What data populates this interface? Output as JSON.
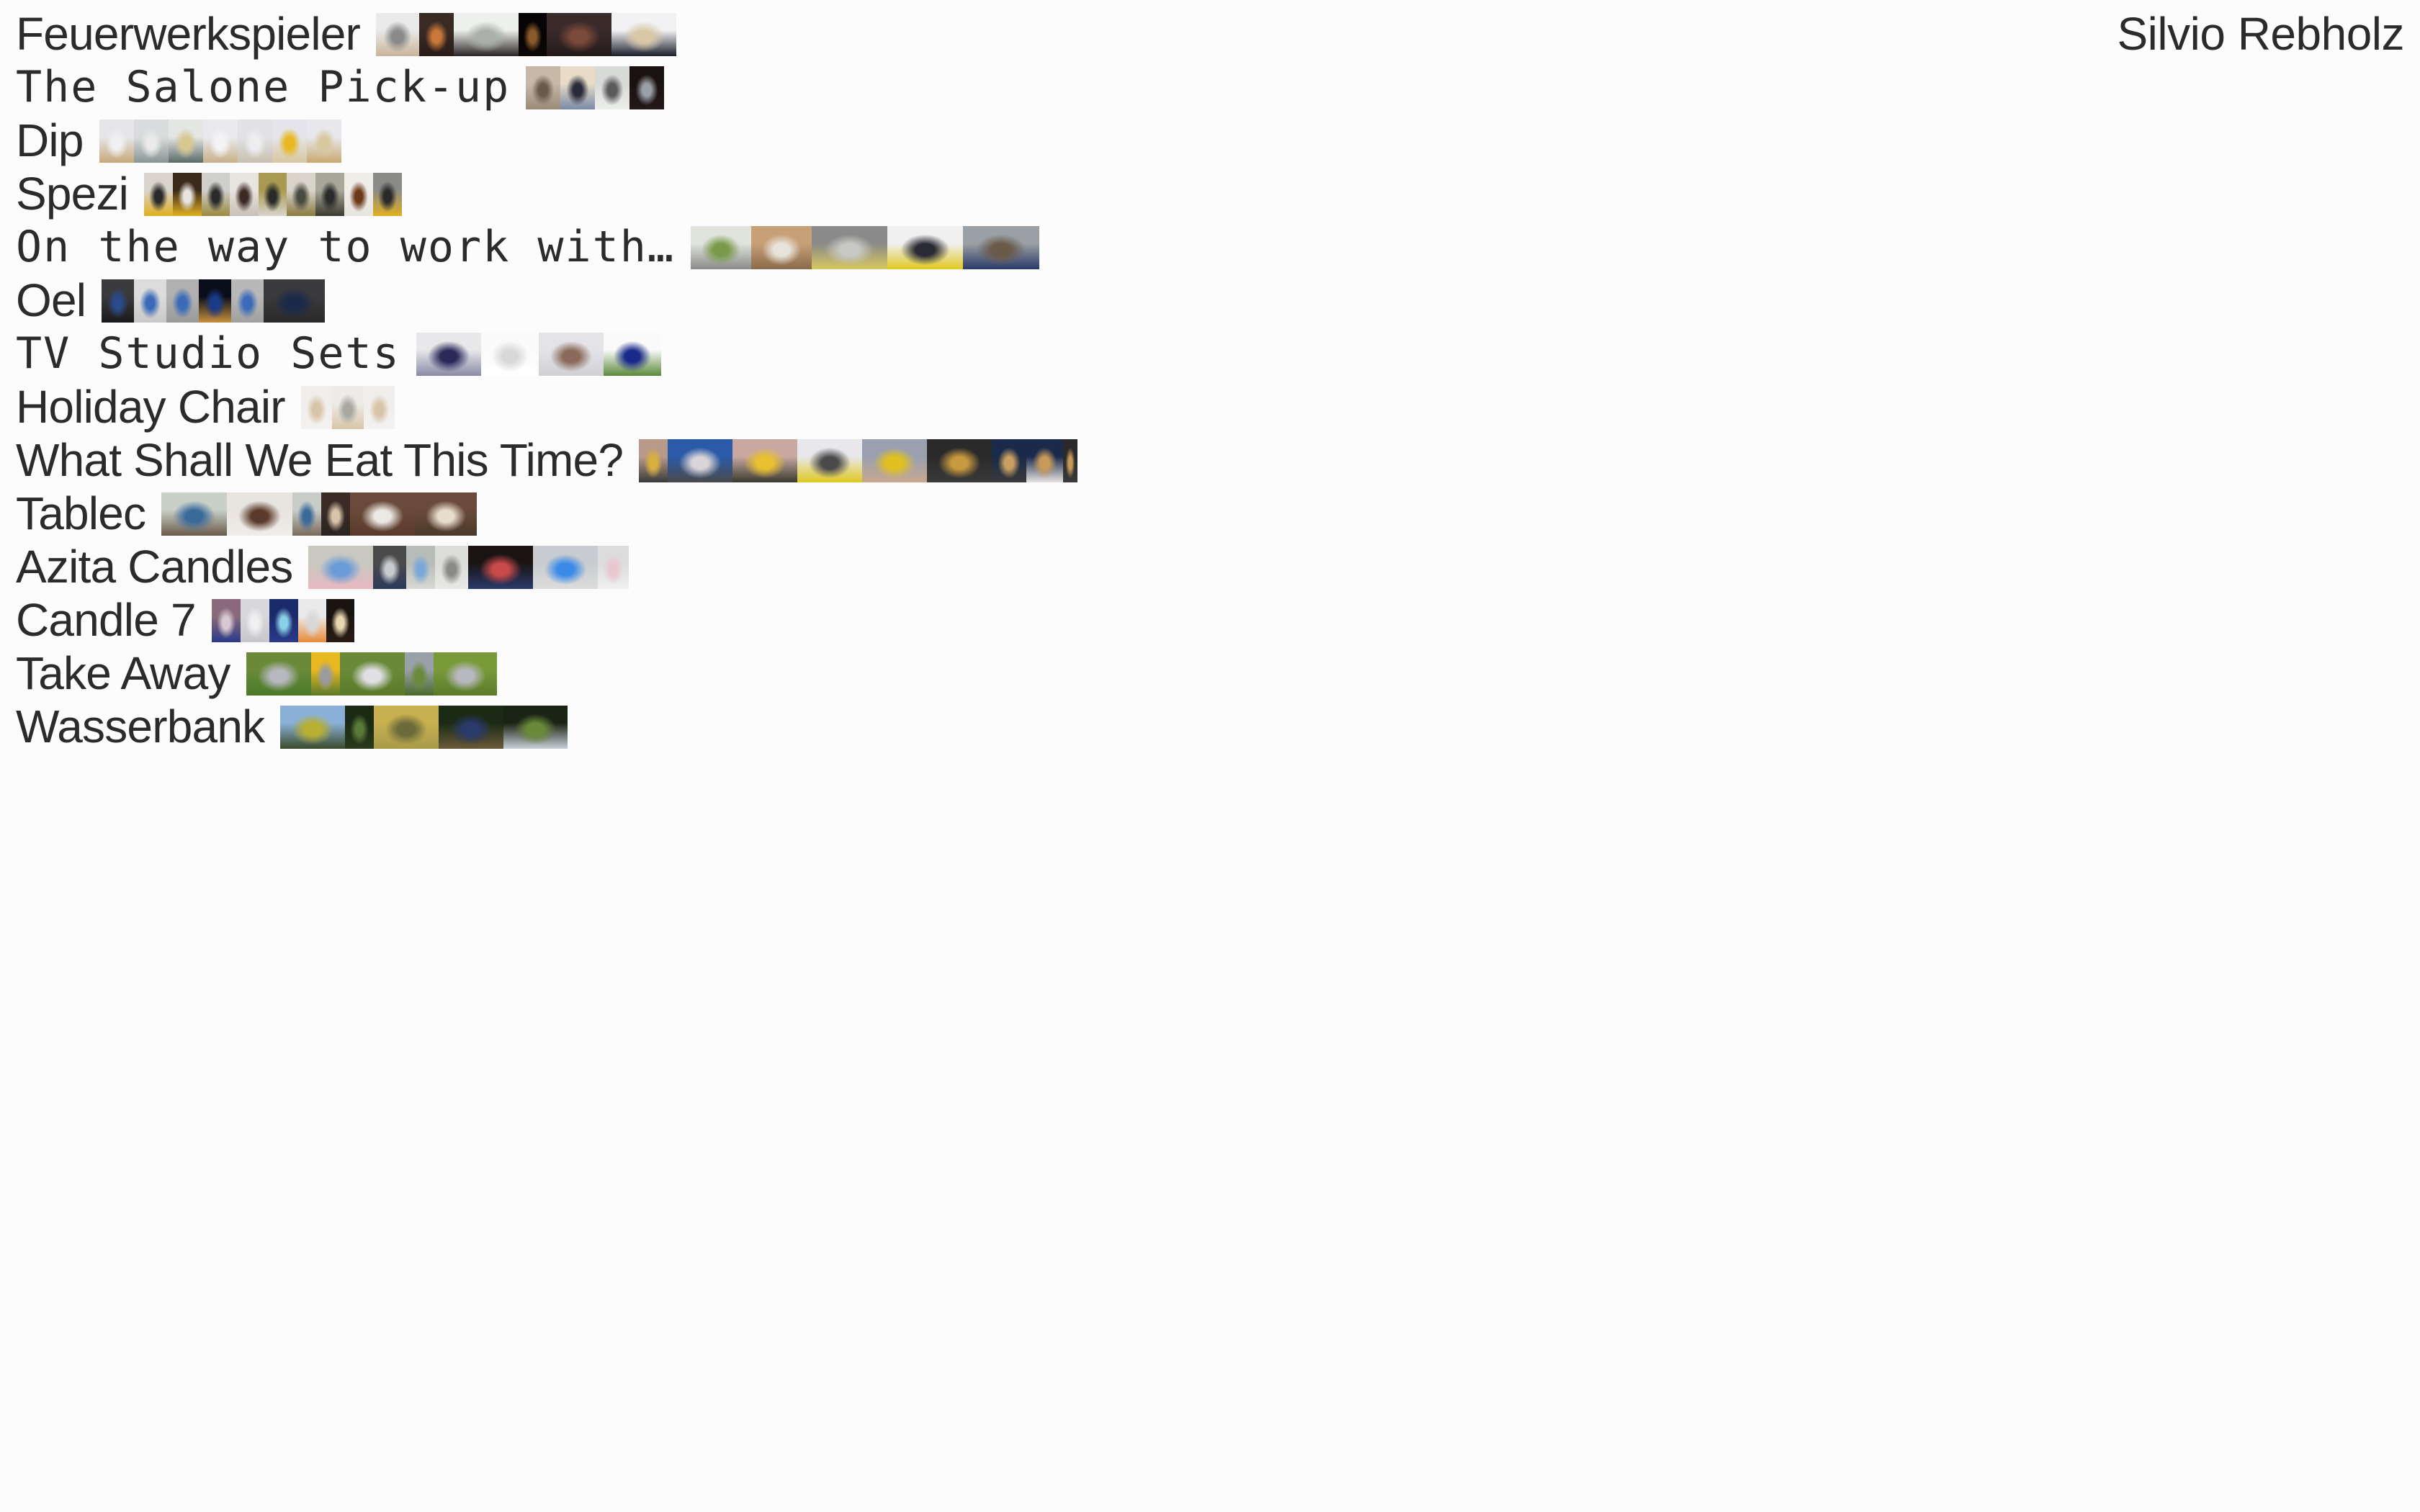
{
  "site": {
    "author": "Silvio Rebholz",
    "background": "#fdfcfd",
    "text_color": "#2b2b2b"
  },
  "projects": [
    {
      "title": "Feuerwerkspieler",
      "font": "sans",
      "thumbnails": [
        {
          "w": 60,
          "c": [
            "#e9e9ea",
            "#8a8a8a",
            "#c9b49a"
          ]
        },
        {
          "w": 48,
          "c": [
            "#3a2a24",
            "#c9783a",
            "#2a1c18"
          ]
        },
        {
          "w": 90,
          "c": [
            "#eef0ee",
            "#a8b0a8",
            "#2a2424"
          ]
        },
        {
          "w": 39,
          "c": [
            "#060404",
            "#8a5a2a",
            "#0c0806"
          ]
        },
        {
          "w": 90,
          "c": [
            "#3a2a2a",
            "#7a4a3a",
            "#241a1a"
          ]
        },
        {
          "w": 90,
          "c": [
            "#f2f2f4",
            "#d8c8a8",
            "#1a1e2a"
          ]
        }
      ]
    },
    {
      "title": "The Salone Pick-up",
      "font": "mono",
      "thumbnails": [
        {
          "w": 48,
          "c": [
            "#c8b8a8",
            "#6a5a4a",
            "#9a8a78"
          ]
        },
        {
          "w": 48,
          "c": [
            "#e8dcc8",
            "#2a2a3a",
            "#7a8aa8"
          ]
        },
        {
          "w": 48,
          "c": [
            "#d8dad8",
            "#5a5a5a",
            "#eceeec"
          ]
        },
        {
          "w": 48,
          "c": [
            "#1a1210",
            "#9aa0a8",
            "#24181a"
          ]
        }
      ]
    },
    {
      "title": "Dip",
      "font": "sans",
      "thumbnails": [
        {
          "w": 48,
          "c": [
            "#e6e6ea",
            "#f0f0f2",
            "#c8a878"
          ]
        },
        {
          "w": 48,
          "c": [
            "#d8dcdc",
            "#eaeaea",
            "#8a9494"
          ]
        },
        {
          "w": 48,
          "c": [
            "#e4e6e4",
            "#d8c890",
            "#5a6a68"
          ]
        },
        {
          "w": 48,
          "c": [
            "#eaeaee",
            "#f4f4f6",
            "#c8b088"
          ]
        },
        {
          "w": 48,
          "c": [
            "#e2e2e6",
            "#eeeef0",
            "#c8c0b0"
          ]
        },
        {
          "w": 48,
          "c": [
            "#e4e4ea",
            "#e8b820",
            "#d8c8a0"
          ]
        },
        {
          "w": 48,
          "c": [
            "#e8e8ec",
            "#d8c8a0",
            "#c8a870"
          ]
        }
      ]
    },
    {
      "title": "Spezi",
      "font": "sans",
      "thumbnails": [
        {
          "w": 40,
          "c": [
            "#d8d4cc",
            "#2a2a2a",
            "#e0b020"
          ]
        },
        {
          "w": 40,
          "c": [
            "#3a2a1a",
            "#e8e4e0",
            "#e0b020"
          ]
        },
        {
          "w": 39,
          "c": [
            "#cfcfcc",
            "#2a2a2a",
            "#9a8a40"
          ]
        },
        {
          "w": 40,
          "c": [
            "#e8e4e0",
            "#3a2a24",
            "#c8c0b8"
          ]
        },
        {
          "w": 39,
          "c": [
            "#a89a50",
            "#2a2a2a",
            "#d8d4cc"
          ]
        },
        {
          "w": 40,
          "c": [
            "#d8d4cc",
            "#4a4a40",
            "#8a7a40"
          ]
        },
        {
          "w": 40,
          "c": [
            "#a8a89a",
            "#2a2a2a",
            "#3a3a30"
          ]
        },
        {
          "w": 40,
          "c": [
            "#f0ece8",
            "#6a3a1a",
            "#e8e4e0"
          ]
        },
        {
          "w": 40,
          "c": [
            "#8a8a88",
            "#2a2a2a",
            "#e0b020"
          ]
        }
      ]
    },
    {
      "title": "On the way to work with…",
      "font": "mono",
      "thumbnails": [
        {
          "w": 84,
          "c": [
            "#e0e4dc",
            "#7a9a4a",
            "#8a8a8a"
          ]
        },
        {
          "w": 84,
          "c": [
            "#c8a078",
            "#e8e4dc",
            "#8a6a4a"
          ]
        },
        {
          "w": 105,
          "c": [
            "#8a8a8a",
            "#c8c8c4",
            "#d8c860"
          ]
        },
        {
          "w": 105,
          "c": [
            "#f0f0f0",
            "#2a2a34",
            "#e0c820"
          ]
        },
        {
          "w": 106,
          "c": [
            "#9aa0a4",
            "#6a5a4a",
            "#2a3a6a"
          ]
        }
      ]
    },
    {
      "title": "Oel",
      "font": "sans",
      "thumbnails": [
        {
          "w": 45,
          "c": [
            "#3a3a3c",
            "#2a4a8a",
            "#1a1a1c"
          ]
        },
        {
          "w": 45,
          "c": [
            "#dcdcdc",
            "#3a6ab8",
            "#c8c8c8"
          ]
        },
        {
          "w": 45,
          "c": [
            "#b0b0b0",
            "#3a6ab8",
            "#9a9a9a"
          ]
        },
        {
          "w": 45,
          "c": [
            "#0a0e1a",
            "#1a3a8a",
            "#c89040"
          ]
        },
        {
          "w": 45,
          "c": [
            "#b8b8b8",
            "#3a6ab8",
            "#a0a0a0"
          ]
        },
        {
          "w": 85,
          "c": [
            "#3a3a3c",
            "#1a2a4a",
            "#2a2a2a"
          ]
        }
      ]
    },
    {
      "title": "TV Studio Sets",
      "font": "mono",
      "thumbnails": [
        {
          "w": 90,
          "c": [
            "#e8e8ea",
            "#2a2a5a",
            "#8a8aa8"
          ]
        },
        {
          "w": 80,
          "c": [
            "#fafafa",
            "#d8d8d8",
            "#ffffff"
          ]
        },
        {
          "w": 90,
          "c": [
            "#e4e4e8",
            "#8a6a5a",
            "#d0d0d4"
          ]
        },
        {
          "w": 80,
          "c": [
            "#fafafa",
            "#1a2a8a",
            "#5a8a3a"
          ]
        }
      ]
    },
    {
      "title": "Holiday Chair",
      "font": "sans",
      "thumbnails": [
        {
          "w": 43,
          "c": [
            "#f0eeec",
            "#d8c4a8",
            "#f4f2f0"
          ]
        },
        {
          "w": 44,
          "c": [
            "#eeece8",
            "#a8a8a0",
            "#d8c4a8"
          ]
        },
        {
          "w": 43,
          "c": [
            "#f0eeec",
            "#d8c4a8",
            "#f4f2f0"
          ]
        }
      ]
    },
    {
      "title": "What Shall We Eat This Time?",
      "font": "sans",
      "thumbnails": [
        {
          "w": 40,
          "c": [
            "#b89a8a",
            "#d8b040",
            "#3a3a3a"
          ]
        },
        {
          "w": 90,
          "c": [
            "#2a5aa8",
            "#d8d4d8",
            "#4a4a4a"
          ]
        },
        {
          "w": 90,
          "c": [
            "#c8a8a0",
            "#e8c030",
            "#3a3a30"
          ]
        },
        {
          "w": 90,
          "c": [
            "#e8e8ec",
            "#4a4a4a",
            "#e0c820"
          ]
        },
        {
          "w": 90,
          "c": [
            "#9aa0b0",
            "#e0c020",
            "#c8a890"
          ]
        },
        {
          "w": 90,
          "c": [
            "#2a2a2a",
            "#c89a40",
            "#3a3a3a"
          ]
        },
        {
          "w": 48,
          "c": [
            "#1a2a4a",
            "#c8a060",
            "#3a3a3a"
          ]
        },
        {
          "w": 51,
          "c": [
            "#1a2a4a",
            "#c89a5a",
            "#e8e4e0"
          ]
        },
        {
          "w": 20,
          "c": [
            "#2a2a2a",
            "#c89a5a",
            "#3a3a3a"
          ]
        }
      ]
    },
    {
      "title": "Tablec",
      "font": "sans",
      "thumbnails": [
        {
          "w": 91,
          "c": [
            "#c8d0c8",
            "#3a6a9a",
            "#6a5a4a"
          ]
        },
        {
          "w": 91,
          "c": [
            "#e8e4e0",
            "#5a3a2a",
            "#f0ece8"
          ]
        },
        {
          "w": 40,
          "c": [
            "#c8ccc8",
            "#3a6a9a",
            "#7a6a5a"
          ]
        },
        {
          "w": 40,
          "c": [
            "#3a2a24",
            "#d8c4a8",
            "#2a2420"
          ]
        },
        {
          "w": 90,
          "c": [
            "#6a4a3a",
            "#ece8e4",
            "#5a3a2a"
          ]
        },
        {
          "w": 86,
          "c": [
            "#6a4a3a",
            "#e8dccc",
            "#4a3a2a"
          ]
        }
      ]
    },
    {
      "title": "Azita Candles",
      "font": "sans",
      "thumbnails": [
        {
          "w": 90,
          "c": [
            "#c8c8c0",
            "#6a9ad8",
            "#e8b8c0"
          ]
        },
        {
          "w": 46,
          "c": [
            "#4a4a4a",
            "#c8ccd0",
            "#2a3a5a"
          ]
        },
        {
          "w": 40,
          "c": [
            "#b8bcb8",
            "#7aa8d8",
            "#d8d8d4"
          ]
        },
        {
          "w": 46,
          "c": [
            "#dcdcd8",
            "#8a8a88",
            "#e8e8e4"
          ]
        },
        {
          "w": 90,
          "c": [
            "#1a1414",
            "#c84a4a",
            "#2a3a6a"
          ]
        },
        {
          "w": 90,
          "c": [
            "#c8ccd0",
            "#3a8ae8",
            "#dcdcdc"
          ]
        },
        {
          "w": 43,
          "c": [
            "#dcdcdc",
            "#e8c8d0",
            "#f0f0f0"
          ]
        }
      ]
    },
    {
      "title": "Candle 7",
      "font": "sans",
      "thumbnails": [
        {
          "w": 40,
          "c": [
            "#8a6a7a",
            "#d8c8d0",
            "#2a3a8a"
          ]
        },
        {
          "w": 40,
          "c": [
            "#d8d8dc",
            "#f0f0f0",
            "#c8c8cc"
          ]
        },
        {
          "w": 40,
          "c": [
            "#1a2a6a",
            "#8ad0e8",
            "#2a3a8a"
          ]
        },
        {
          "w": 39,
          "c": [
            "#eaeaea",
            "#d8d8d8",
            "#e88a3a"
          ]
        },
        {
          "w": 39,
          "c": [
            "#1a1410",
            "#e8d8b0",
            "#2a1a14"
          ]
        }
      ]
    },
    {
      "title": "Take Away",
      "font": "sans",
      "thumbnails": [
        {
          "w": 90,
          "c": [
            "#6a8a3a",
            "#b8b8c0",
            "#4a7a2a"
          ]
        },
        {
          "w": 40,
          "c": [
            "#e8b820",
            "#9a9aa0",
            "#5a7a2a"
          ]
        },
        {
          "w": 90,
          "c": [
            "#6a8a3a",
            "#e0e0e4",
            "#5a7a2a"
          ]
        },
        {
          "w": 40,
          "c": [
            "#9aa0a8",
            "#6a8a3a",
            "#4a6a2a"
          ]
        },
        {
          "w": 88,
          "c": [
            "#7a9a3a",
            "#b8b8c0",
            "#5a7a2a"
          ]
        }
      ]
    },
    {
      "title": "Wasserbank",
      "font": "sans",
      "thumbnails": [
        {
          "w": 90,
          "c": [
            "#8ab0d8",
            "#b8b030",
            "#3a4a2a"
          ]
        },
        {
          "w": 40,
          "c": [
            "#1a2a14",
            "#5a7a3a",
            "#2a3a1a"
          ]
        },
        {
          "w": 90,
          "c": [
            "#c8b050",
            "#6a6a3a",
            "#a89a4a"
          ]
        },
        {
          "w": 90,
          "c": [
            "#1a2a14",
            "#2a3a6a",
            "#6a5a3a"
          ]
        },
        {
          "w": 89,
          "c": [
            "#1a2414",
            "#6a8a3a",
            "#c8d0d8"
          ]
        }
      ]
    }
  ]
}
